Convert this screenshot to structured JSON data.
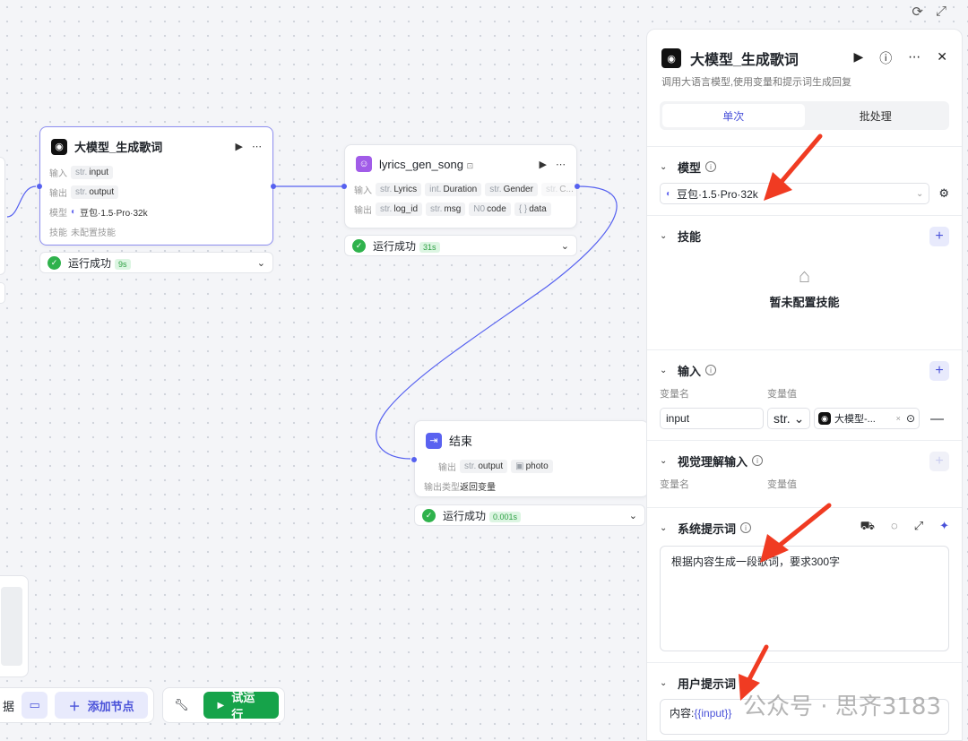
{
  "canvas": {
    "top_icons": [
      "refresh-icon",
      "fullscreen-icon"
    ],
    "node_llm": {
      "title": "大模型_生成歌词",
      "input_label": "输入",
      "input_var": {
        "type": "str.",
        "name": "input"
      },
      "output_label": "输出",
      "output_var": {
        "type": "str.",
        "name": "output"
      },
      "model_label": "模型",
      "model_value": "豆包·1.5·Pro·32k",
      "skill_label": "技能",
      "skill_value": "未配置技能",
      "status": "运行成功",
      "duration": "9s"
    },
    "node_plugin": {
      "title": "lyrics_gen_song",
      "input_label": "输入",
      "inputs": [
        {
          "type": "str.",
          "name": "Lyrics"
        },
        {
          "type": "int.",
          "name": "Duration"
        },
        {
          "type": "str.",
          "name": "Gender"
        },
        {
          "type": "str.",
          "name": "C..."
        }
      ],
      "output_label": "输出",
      "outputs": [
        {
          "type": "str.",
          "name": "log_id"
        },
        {
          "type": "str.",
          "name": "msg"
        },
        {
          "type": "N0",
          "name": "code"
        },
        {
          "type": "{ }",
          "name": "data"
        }
      ],
      "status": "运行成功",
      "duration": "31s"
    },
    "node_end": {
      "title": "结束",
      "output_label": "输出",
      "outputs": [
        {
          "type": "str.",
          "name": "output"
        },
        {
          "type": "▣",
          "name": "photo"
        }
      ],
      "output_type_label": "输出类型",
      "output_type_value": "返回变量",
      "status": "运行成功",
      "duration": "0.001s"
    },
    "toolbar": {
      "partial_label": "据",
      "add_node_label": "添加节点",
      "test_run_label": "试运行"
    }
  },
  "panel": {
    "title": "大模型_生成歌词",
    "description": "调用大语言模型,使用变量和提示词生成回复",
    "tabs": [
      {
        "label": "单次",
        "active": true
      },
      {
        "label": "批处理",
        "active": false
      }
    ],
    "model": {
      "section": "模型",
      "value": "豆包·1.5·Pro·32k"
    },
    "skills": {
      "section": "技能",
      "empty_text": "暂未配置技能"
    },
    "inputs": {
      "section": "输入",
      "col_name": "变量名",
      "col_value": "变量值",
      "var_name": "input",
      "var_type": "str.",
      "var_ref": "大模型-..."
    },
    "vision": {
      "section": "视觉理解输入",
      "col_name": "变量名",
      "col_value": "变量值"
    },
    "system_prompt": {
      "section": "系统提示词",
      "text": "根据内容生成一段歌词，要求300字"
    },
    "user_prompt": {
      "section": "用户提示词",
      "prefix": "内容:",
      "var": "{{input}}"
    }
  },
  "watermark": "公众号 · 思齐3183",
  "colors": {
    "accent": "#4a52d9",
    "success": "#2fb24c",
    "arrow": "#f03b22",
    "edge": "#5661f0"
  }
}
